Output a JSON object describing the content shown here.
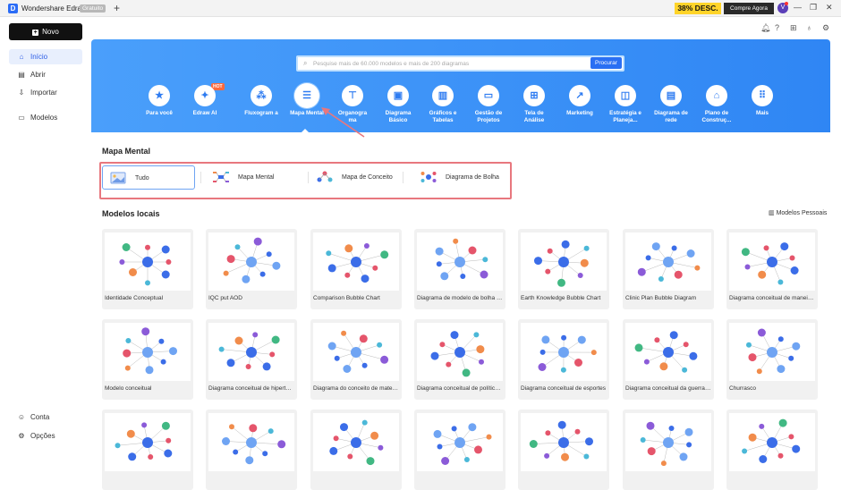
{
  "titlebar": {
    "app_name": "Wondershare EdrawMax",
    "badge": "Gratuito",
    "promo": "38% DESC.",
    "buy": "Compre Agora",
    "avatar": "V"
  },
  "sidebar": {
    "new_button": "Novo",
    "items": [
      {
        "label": "Início",
        "icon": "home-icon"
      },
      {
        "label": "Abrir",
        "icon": "folder-icon"
      },
      {
        "label": "Importar",
        "icon": "import-icon"
      },
      {
        "label": "Modelos",
        "icon": "templates-icon"
      }
    ],
    "footer": [
      {
        "label": "Conta",
        "icon": "user-icon"
      },
      {
        "label": "Opções",
        "icon": "gear-icon"
      }
    ]
  },
  "search": {
    "placeholder": "Pesquise mais de 60.000 modelos e mais de 200 diagramas",
    "button": "Procurar"
  },
  "categories": [
    {
      "label": "Para você",
      "icon": "star-icon"
    },
    {
      "label": "Edraw AI",
      "icon": "ai-icon",
      "badge": "HOT"
    },
    {
      "label": "Fluxogram a",
      "icon": "flowchart-icon"
    },
    {
      "label": "Mapa Mental",
      "icon": "mindmap-icon"
    },
    {
      "label": "Organogra ma",
      "icon": "orgchart-icon"
    },
    {
      "label": "Diagrama Básico",
      "icon": "basic-diagram-icon"
    },
    {
      "label": "Gráficos e Tabelas",
      "icon": "chart-icon"
    },
    {
      "label": "Gestão de Projetos",
      "icon": "project-icon"
    },
    {
      "label": "Tela de Análise",
      "icon": "canvas-icon"
    },
    {
      "label": "Marketing",
      "icon": "marketing-icon"
    },
    {
      "label": "Estratégia e Planeja...",
      "icon": "strategy-icon"
    },
    {
      "label": "Diagrama de rede",
      "icon": "network-icon"
    },
    {
      "label": "Plano de Construç...",
      "icon": "building-icon"
    },
    {
      "label": "Mais",
      "icon": "more-icon"
    }
  ],
  "section_title": "Mapa Mental",
  "filters": [
    {
      "label": "Tudo"
    },
    {
      "label": "Mapa Mental"
    },
    {
      "label": "Mapa de Conceito"
    },
    {
      "label": "Diagrama de Bolha"
    }
  ],
  "local_title": "Modelos locais",
  "personal_label": "Modelos Pessoais",
  "templates": [
    "Identidade Conceptual",
    "IQC put AOD",
    "Comparison Bubble Chart",
    "Diagrama de modelo de bolha dupla",
    "Earth Knowledge Bubble Chart",
    "Clinic Plan Bubble Diagram",
    "Diagrama conceitual de maneiras d...",
    "Modelo conceitual",
    "Diagrama conceitual de hipertensã...",
    "Diagrama do conceito de matemát...",
    "Diagrama conceitual de políticas p...",
    "Diagrama conceitual de esportes",
    "Diagrama conceitual da guerra mu...",
    "Churrasco",
    "",
    "",
    "",
    "",
    "",
    "",
    ""
  ],
  "colors": {
    "accent": "#2f86f4",
    "highlight": "#e8777e"
  }
}
